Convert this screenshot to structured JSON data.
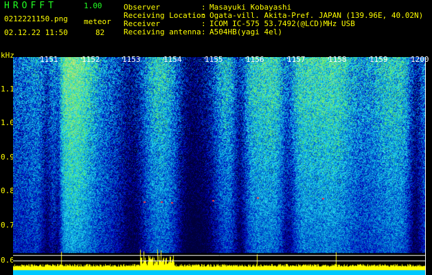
{
  "header": {
    "app_name": "HROFFT",
    "version": "1.00",
    "filename": "0212221150.png",
    "mode": "meteor",
    "datetime": "02.12.22 11:50",
    "count": "82"
  },
  "info": [
    {
      "label": "Observer",
      "value": "Masayuki Kobayashi"
    },
    {
      "label": "Receiving Location",
      "value": "Ogata-vill. Akita-Pref. JAPAN (139.96E, 40.02N)"
    },
    {
      "label": "Receiver",
      "value": "ICOM IC-575 53.7492(@LCD)MHz USB"
    },
    {
      "label": "Receiving antenna",
      "value": "A504HB(yagi 4el)"
    }
  ],
  "spectrogram": {
    "y_axis_unit": "kHz",
    "y_ticks": [
      "1.1",
      "1.0",
      "0.9",
      "0.8",
      "0.7",
      "0.6"
    ],
    "time_ticks": [
      "1151",
      "1152",
      "1153",
      "1154",
      "1155",
      "1156",
      "1157",
      "1158",
      "1159",
      "1200"
    ],
    "colors": {
      "background": "#000000",
      "noise_low": "#0000a0",
      "noise_high": "#20c8ff",
      "signal": "#ffff00",
      "echo": "#ff4040",
      "baseline": "#00c8ff"
    }
  }
}
